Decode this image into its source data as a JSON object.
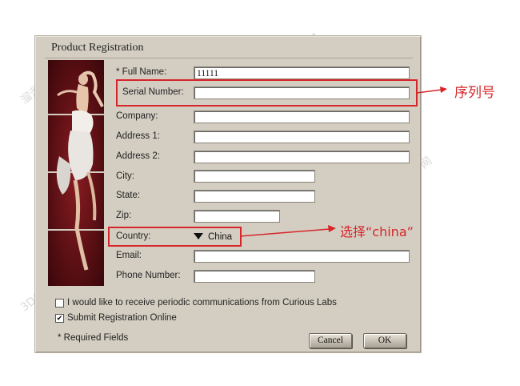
{
  "dialog": {
    "title": "Product Registration",
    "fields": [
      {
        "label": "* Full Name:",
        "value": "11111"
      },
      {
        "label": "Serial Number:",
        "value": ""
      },
      {
        "label": "Company:",
        "value": ""
      },
      {
        "label": "Address 1:",
        "value": ""
      },
      {
        "label": "Address 2:",
        "value": ""
      },
      {
        "label": "City:",
        "value": ""
      },
      {
        "label": "State:",
        "value": ""
      },
      {
        "label": "Zip:",
        "value": ""
      },
      {
        "label": "Email:",
        "value": ""
      },
      {
        "label": "Phone Number:",
        "value": ""
      }
    ],
    "country": {
      "label": "Country:",
      "value": "China"
    },
    "checkboxes": [
      {
        "label": "I would like to receive periodic communications from Curious Labs",
        "checked": false
      },
      {
        "label": "Submit Registration Online",
        "checked": true
      }
    ],
    "required_note": "* Required Fields",
    "cancel_label": "Cancel",
    "ok_label": "OK"
  },
  "annotations": {
    "serial_note": "序列号",
    "country_note": "选择“china”",
    "accent_color": "#d7262a"
  },
  "watermark": {
    "text_a": "3D66.COM",
    "text_b": "溜溜自学网"
  }
}
